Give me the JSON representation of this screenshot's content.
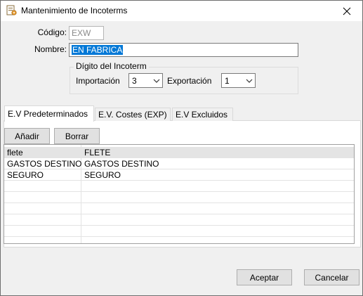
{
  "window": {
    "title": "Mantenimiento de Incoterms"
  },
  "form": {
    "codigo_label": "Código:",
    "codigo_value": "EXW",
    "nombre_label": "Nombre:",
    "nombre_value": "EN FABRICA",
    "digito_group_label": "Dígito del Incoterm",
    "importacion_label": "Importación",
    "importacion_value": "3",
    "exportacion_label": "Exportación",
    "exportacion_value": "1"
  },
  "tabs": [
    {
      "label": "E.V Predeterminados"
    },
    {
      "label": "E.V. Costes (EXP)"
    },
    {
      "label": "E.V Excluidos"
    }
  ],
  "panel": {
    "add_label": "Añadir",
    "delete_label": "Borrar"
  },
  "grid": {
    "rows": [
      {
        "code": "flete",
        "name": "FLETE"
      },
      {
        "code": "GASTOS DESTINO",
        "name": "GASTOS DESTINO"
      },
      {
        "code": "SEGURO",
        "name": "SEGURO"
      }
    ]
  },
  "footer": {
    "accept_label": "Aceptar",
    "cancel_label": "Cancelar"
  },
  "colors": {
    "selection": "#0078d7",
    "button_face": "#e1e1e1",
    "window_bg": "#f0f0f0"
  },
  "icons": {
    "app": "document-settings-icon",
    "close": "close-icon",
    "dropdown": "chevron-down-icon"
  }
}
